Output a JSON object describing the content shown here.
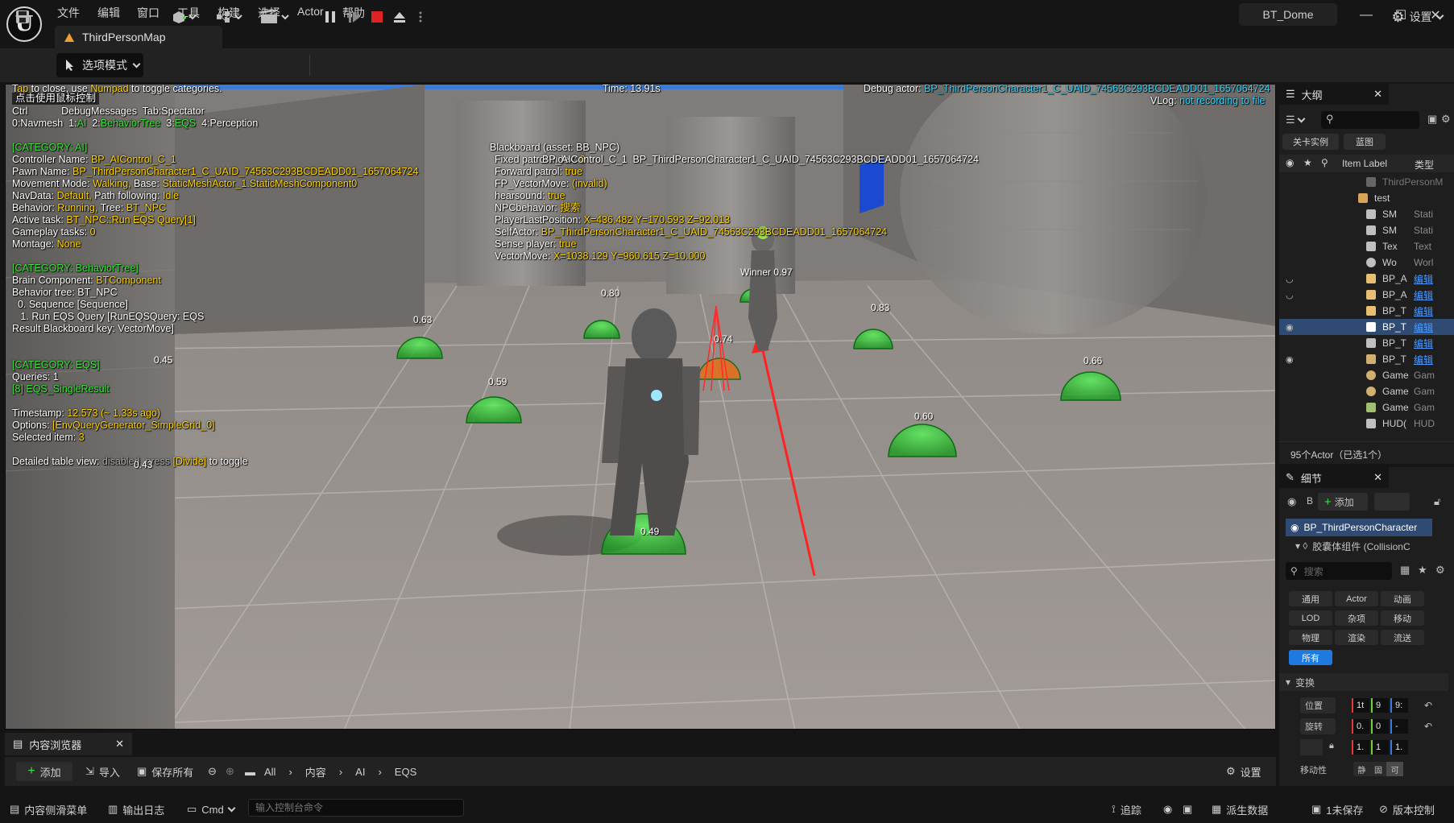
{
  "titlebar": {
    "logo_glyph": "U",
    "menu": [
      "文件",
      "编辑",
      "窗口",
      "工具",
      "构建",
      "选择",
      "Actor",
      "帮助"
    ],
    "tab_label": "ThirdPersonMap",
    "project_name": "BT_Dome",
    "window_controls": [
      "—",
      "☐",
      "✕"
    ]
  },
  "toolbar": {
    "mode_label": "选项模式",
    "settings_label": "设置"
  },
  "viewport": {
    "hint_line1_a": "T",
    "hint_line1_b": "ap",
    "hint_line1_c": "to close, use",
    "hint_line1_numpad": "Numpad",
    "hint_line1_d": "to toggle categories.",
    "mouse_control_tip": "点击使用鼠标控制",
    "hint_line2_a": "Ctrl",
    "hint_line2_b": "DebugMessages  Tab:Spectator",
    "categories_prefix": "0:Navmesh  1:",
    "cat_ai": "AI",
    "cat_bt_prefix": "2:",
    "cat_bt": "BehaviorTree",
    "cat_eqs_prefix": "3:",
    "cat_eqs": "EQS",
    "cat_perc": "4:Perception",
    "time": "Time: 13.91s",
    "debug_actor_label": "Debug actor:",
    "debug_actor_value": "BP_ThirdPersonCharacter1_C_UAID_74563C293BCDEADD01_1657064724",
    "vlog_label": "VLog:",
    "vlog_value": "not recording to file",
    "ai": {
      "header": "[CATEGORY: AI]",
      "controller_label": "Controller Name:",
      "controller": "BP_AIControl_C_1",
      "pawn_label": "Pawn Name:",
      "pawn": "BP_ThirdPersonCharacter1_C_UAID_74563C293BCDEADD01_1657064724",
      "movement_label": "Movement Mode:",
      "movement": "Walking,",
      "base_label": "Base:",
      "base": "StaticMeshActor_1.StaticMeshComponent0",
      "navdata_label": "NavData:",
      "navdata": "Default,",
      "pathfollow_label": "Path following:",
      "pathfollow": "Idle",
      "behavior_label": "Behavior:",
      "behavior": "Running,",
      "tree_label": "Tree:",
      "tree": "BT_NPC",
      "active_task_label": "Active task:",
      "active_task": "BT_NPC::Run EQS Query[1]",
      "gameplay_label": "Gameplay tasks:",
      "gameplay": "0",
      "montage_label": "Montage:",
      "montage": "None"
    },
    "bt": {
      "header": "[CATEGORY: BehaviorTree]",
      "brain_label": "Brain Component:",
      "brain": "BTComponent",
      "tree_line": "Behavior tree: BT_NPC",
      "node0": "  0. Sequence [Sequence]",
      "node1": "   1. Run EQS Query [RunEQSQuery: EQS",
      "result_key": "Result Blackboard key: VectorMove]"
    },
    "eqs": {
      "header": "[CATEGORY: EQS]",
      "queries": "Queries: 1",
      "single": "[8] EQS_SingleResult",
      "timestamp_label": "Timestamp:",
      "timestamp": "12.573 (~ 1.33s ago)",
      "options_label": "Options:",
      "options": "[EnvQueryGenerator_SimpleGrid_0]",
      "selected_label": "Selected item:",
      "selected": "3",
      "table_a": "Detailed table view:",
      "table_b": "disabled, press",
      "table_c": "[Divide]",
      "table_d": "to toggle"
    },
    "blackboard": {
      "header": "Blackboard (asset: BB_NPC)",
      "fixed_label": "Fixed patrol index:",
      "fixed": "0",
      "overlay_name": "BP_AIControl_C_1  BP_ThirdPersonCharacter1_C_UAID_74563C293BCDEADD01_1657064724",
      "forward_label": "Forward patrol:",
      "forward": "true",
      "fp_label": "FP_VectorMove:",
      "fp": "(invalid)",
      "hear_label": "hearsound:",
      "hear": "true",
      "npc_label": "NPCbehavior:",
      "npc": "搜索",
      "plp_label": "PlayerLastPosition:",
      "plp": "X=436.482 Y=170.593 Z=92.013",
      "self_label": "SelfActor:",
      "self": "BP_ThirdPersonCharacter1_C_UAID_74563C293BCDEADD01_1657064724",
      "sense_label": "Sense player:",
      "sense": "true",
      "vm_label": "VectorMove:",
      "vm": "X=1038.129 Y=960.615 Z=10.000"
    },
    "eqs_scores": {
      "winner": "Winner 0.97",
      "s_063": "0.63",
      "s_080": "0.80",
      "s_083": "0.83",
      "s_074": "0.74",
      "s_066": "0.66",
      "s_059": "0.59",
      "s_060": "0.60",
      "s_049": "0.49",
      "s_045": "0.45",
      "s_043": "0.43"
    }
  },
  "outliner": {
    "title": "大纲",
    "btn_level": "关卡实例",
    "btn_bp": "蓝图",
    "col_label": "Item Label",
    "col_type": "类型",
    "rows": [
      {
        "name": "ThirdPersonM",
        "type": ""
      },
      {
        "name": "test",
        "type": ""
      },
      {
        "name": "SM",
        "type": "Stati"
      },
      {
        "name": "SM",
        "type": "Stati"
      },
      {
        "name": "Tex",
        "type": "Text"
      },
      {
        "name": "Wo",
        "type": "Worl"
      },
      {
        "name": "BP_A",
        "type": "编辑"
      },
      {
        "name": "BP_A",
        "type": "编辑"
      },
      {
        "name": "BP_T",
        "type": "编辑"
      },
      {
        "name": "BP_T",
        "type": "编辑"
      },
      {
        "name": "BP_T",
        "type": "编辑"
      },
      {
        "name": "BP_T",
        "type": "编辑"
      },
      {
        "name": "Game",
        "type": "Gam"
      },
      {
        "name": "Game",
        "type": "Gam"
      },
      {
        "name": "Game",
        "type": "Gam"
      },
      {
        "name": "HUD(",
        "type": "HUD"
      }
    ],
    "summary": "95个Actor（已选1个）"
  },
  "details": {
    "title": "细节",
    "b_label": "B",
    "add_label": "添加",
    "selected_actor": "BP_ThirdPersonCharacter",
    "component": "胶囊体组件 (CollisionC",
    "search_placeholder": "搜索",
    "cats": [
      "通用",
      "Actor",
      "动画",
      "LOD",
      "杂项",
      "移动",
      "物理",
      "渲染",
      "流送",
      "所有"
    ],
    "transform_header": "变换",
    "loc_label": "位置",
    "rot_label": "旋转",
    "loc_vals": [
      "1t",
      "9",
      "9:"
    ],
    "rot_vals": [
      "0.",
      "0",
      "-"
    ],
    "scale_vals": [
      "1.",
      "1",
      "1."
    ],
    "mobility_label": "移动性",
    "mobility_opts": [
      "静",
      "固",
      "可"
    ],
    "anim_label": "动画"
  },
  "content_browser": {
    "tab": "内容浏览器",
    "add": "添加",
    "import": "导入",
    "save_all": "保存所有",
    "path": [
      "All",
      "内容",
      "AI",
      "EQS"
    ],
    "settings": "设置"
  },
  "statusbar": {
    "drawer": "内容侧滑菜单",
    "output_log": "输出日志",
    "cmd": "Cmd",
    "cmd_placeholder": "输入控制台命令",
    "trace": "追踪",
    "derived_data": "派生数据",
    "unsaved": "1未保存",
    "source_control": "版本控制"
  },
  "colors": {
    "eqs_green": "#2fd03a",
    "selection_blue": "#1f7ae0",
    "hud_yellow": "#ffd400",
    "hud_cyan": "#33d6ff"
  }
}
